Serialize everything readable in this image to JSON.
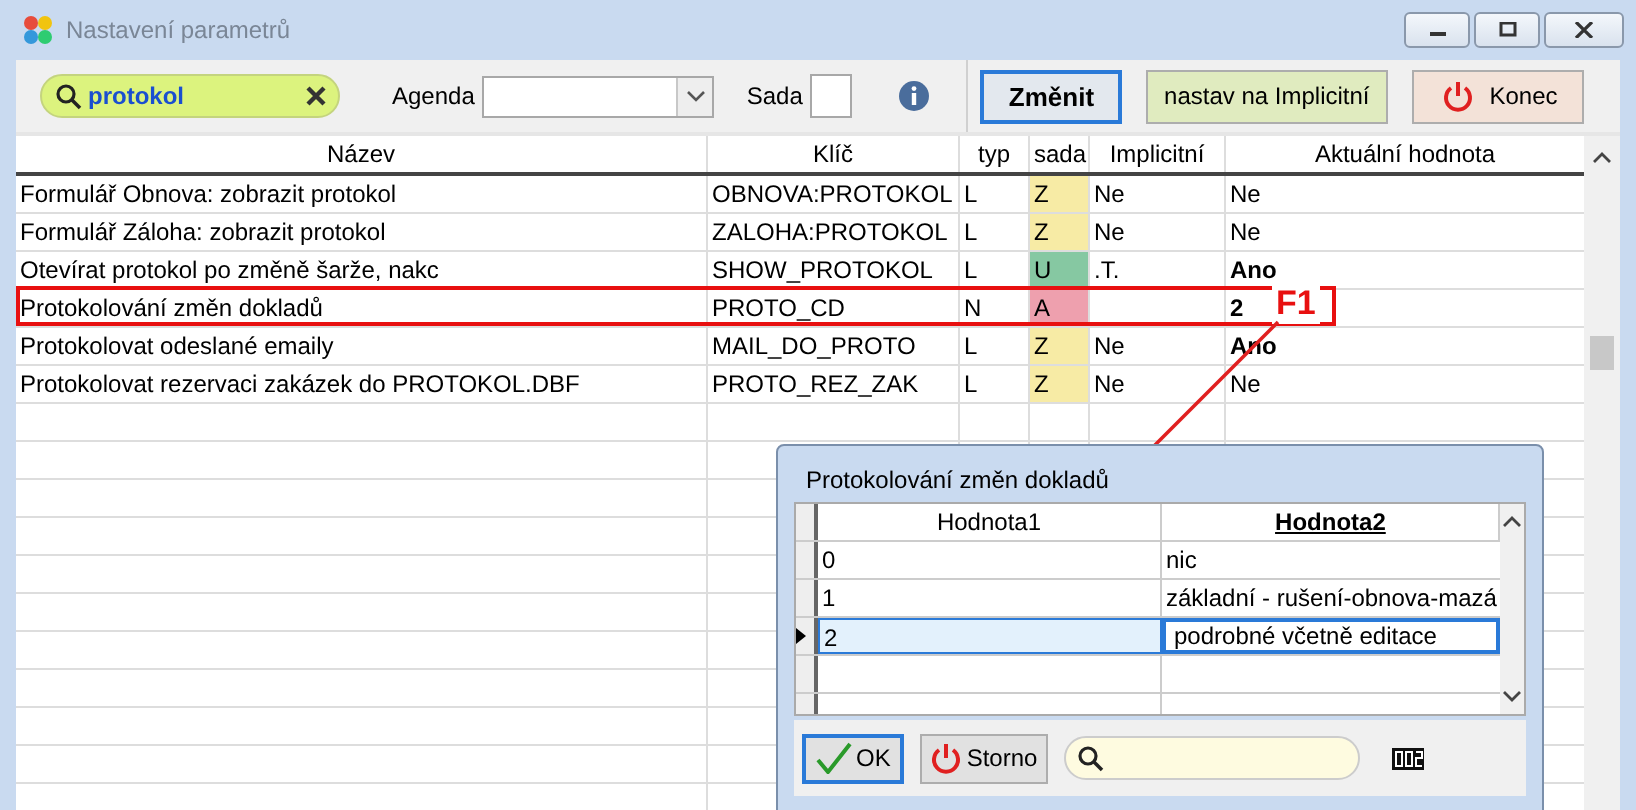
{
  "window": {
    "title": "Nastavení parametrů"
  },
  "toolbar": {
    "search": {
      "value": "protokol"
    },
    "agenda_label": "Agenda",
    "sada_label": "Sada",
    "buttons": [
      {
        "label": "Změnit",
        "kind": "primary"
      },
      {
        "label": "nastav na Implicitní",
        "kind": "default"
      },
      {
        "label": "Konec",
        "kind": "exit"
      }
    ]
  },
  "table": {
    "columns": [
      "Název",
      "Klíč",
      "typ",
      "sada",
      "Implicitní",
      "Aktuální hodnota"
    ],
    "rows": [
      {
        "name": "Formulář Obnova: zobrazit protokol",
        "key": "OBNOVA:PROTOKOL",
        "type": "L",
        "set": "Z",
        "color": "#f7eba5",
        "default": "Ne",
        "value": "Ne",
        "changed": false,
        "highlighted": false
      },
      {
        "name": "Formulář Záloha: zobrazit protokol",
        "key": "ZALOHA:PROTOKOL",
        "type": "L",
        "set": "Z",
        "color": "#f7eba5",
        "default": "Ne",
        "value": "Ne",
        "changed": false,
        "highlighted": false
      },
      {
        "name": "Otevírat protokol po změně šarže, nakc",
        "key": "SHOW_PROTOKOL",
        "type": "L",
        "set": "U",
        "color": "#86c8a2",
        "default": ".T.",
        "value": "Ano",
        "changed": true,
        "highlighted": false
      },
      {
        "name": "Protokolování změn dokladů",
        "key": "PROTO_CD",
        "type": "N",
        "set": "A",
        "color": "#eea0ae",
        "value": "2",
        "changed": true,
        "highlighted": true
      },
      {
        "name": "Protokolovat odeslané emaily",
        "key": "MAIL_DO_PROTO",
        "type": "L",
        "set": "Z",
        "color": "#f7eba5",
        "default": "Ne",
        "value": "Ano",
        "changed": true,
        "highlighted": false
      },
      {
        "name": "Protokolovat rezervaci zakázek do PROTOKOL.DBF",
        "key": "PROTO_REZ_ZAK",
        "type": "L",
        "set": "Z",
        "color": "#f7eba5",
        "default": "Ne",
        "value": "Ne",
        "changed": false,
        "highlighted": false
      }
    ]
  },
  "annotation": {
    "label": "F1"
  },
  "dialog": {
    "title": "Protokolování změn dokladů",
    "columns": [
      "Hodnota1",
      "Hodnota2"
    ],
    "rows": [
      {
        "value1": "0",
        "value2": "nic",
        "selected": false
      },
      {
        "value1": "1",
        "value2": "základní - rušení-obnova-mazá",
        "selected": false
      },
      {
        "value1": "2",
        "value2": "podrobné včetně editace",
        "selected": true
      }
    ],
    "buttons": [
      {
        "label": "OK",
        "kind": "ok"
      },
      {
        "label": "Storno",
        "kind": "cancel"
      }
    ]
  }
}
